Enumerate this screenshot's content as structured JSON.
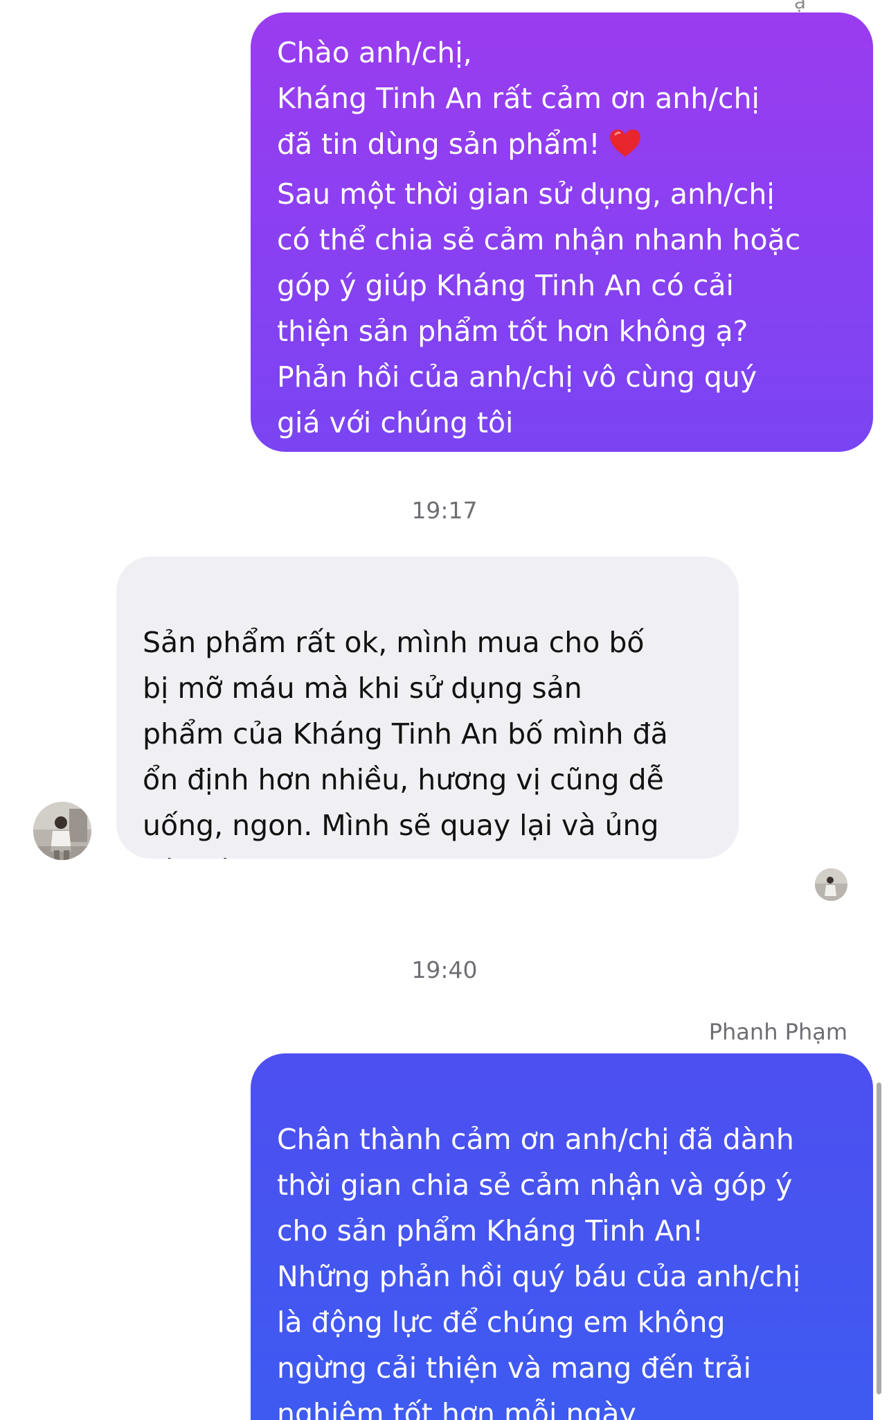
{
  "conversation": {
    "top_cut_text": "ạ",
    "messages": [
      {
        "direction": "outgoing",
        "text_before_emoji": "Chào anh/chị,\nKháng Tinh An rất cảm ơn anh/chị\nđã tin dùng sản phẩm! ",
        "emoji": "red-heart",
        "text_after_emoji": "\nSau một thời gian sử dụng, anh/chị\ncó thể chia sẻ cảm nhận nhanh hoặc\ngóp ý giúp Kháng Tinh An có cải\nthiện sản phẩm tốt hơn không ạ?\nPhản hồi của anh/chị vô cùng quý\ngiá với chúng tôi",
        "color": "#8b3ff1"
      },
      {
        "timestamp": "19:17"
      },
      {
        "direction": "incoming",
        "text": "Sản phẩm rất ok, mình mua cho bố\nbị mỡ máu mà khi sử dụng sản\nphẩm của Kháng Tinh An bố mình đã\nổn định hơn nhiều, hương vị cũng dễ\nuống, ngon. Mình sẽ quay lại và ủng\nhộ thêm",
        "color": "#f0f0f4"
      },
      {
        "timestamp": "19:40"
      },
      {
        "direction": "outgoing",
        "sender": "Phanh Phạm",
        "text": "Chân thành cảm ơn anh/chị đã dành\nthời gian chia sẻ cảm nhận và góp ý\ncho sản phẩm Kháng Tinh An!\nNhững phản hồi quý báu của anh/chị\nlà động lực để chúng em không\nngừng cải thiện và mang đến trải\nnghiệm tốt hơn mỗi ngày.\nRất mong sẽ tiếp tục nhận được sự",
        "color": "#4356f1"
      }
    ]
  },
  "icons": {
    "contact_avatar": "contact-avatar-icon",
    "seen_receipt_avatar": "seen-avatar-icon",
    "emoji": "red-heart-icon"
  }
}
